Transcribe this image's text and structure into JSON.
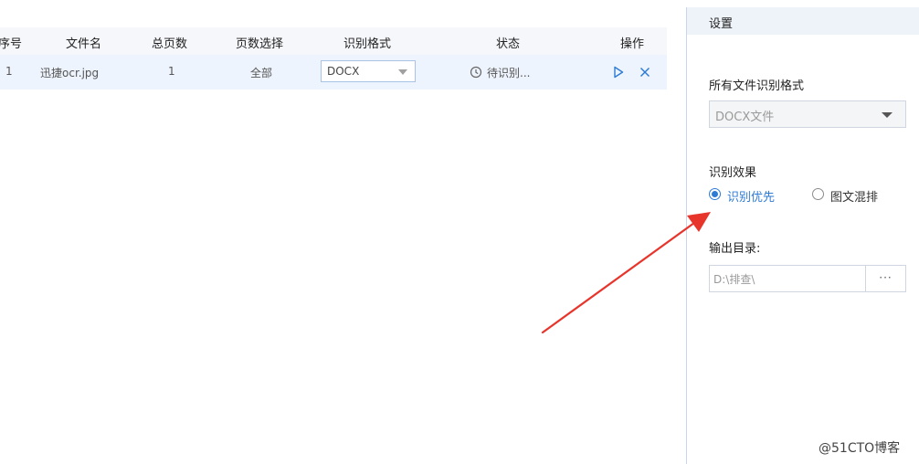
{
  "table": {
    "headers": [
      "序号",
      "文件名",
      "总页数",
      "页数选择",
      "识别格式",
      "状态",
      "操作"
    ],
    "rows": [
      {
        "index": "1",
        "filename": "迅捷ocr.jpg",
        "pages": "1",
        "page_selection": "全部",
        "format": "DOCX",
        "status": "待识别..."
      }
    ]
  },
  "settings": {
    "title": "设置",
    "format_label": "所有文件识别格式",
    "format_value": "DOCX文件",
    "effect_label": "识别效果",
    "effect_options": [
      "识别优先",
      "图文混排"
    ],
    "effect_selected": "识别优先",
    "output_label": "输出目录:",
    "output_path": "D:\\排查\\",
    "browse_label": "···"
  },
  "colors": {
    "accent": "#2e7bd6",
    "annotation_arrow": "#e8352c"
  },
  "icons": {
    "status": "clock-icon",
    "start": "play-icon",
    "remove": "close-icon"
  },
  "watermark": "@51CTO博客"
}
